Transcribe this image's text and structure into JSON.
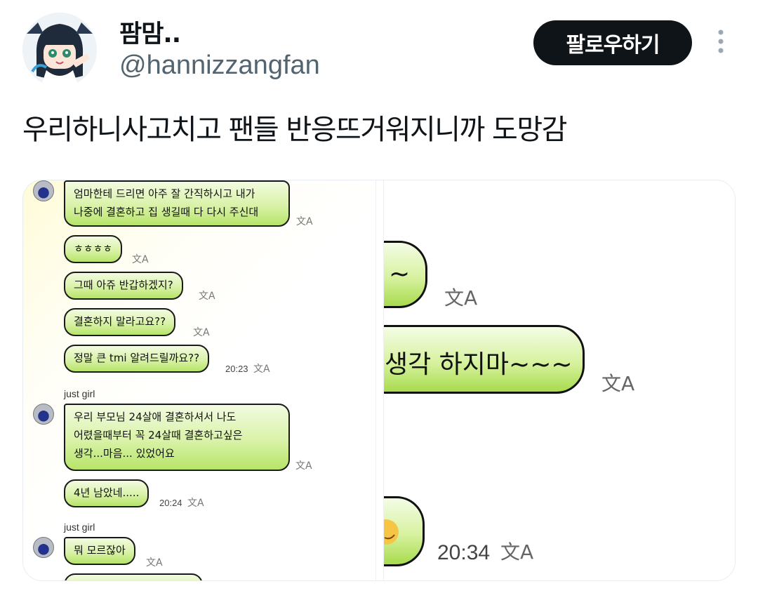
{
  "header": {
    "display_name": "팜맘..",
    "handle": "@hannizzangfan",
    "follow_label": "팔로우하기",
    "more_icon": "more-vertical-icon"
  },
  "tweet": {
    "text": "우리하니사고치고 팬들 반응뜨거워지니까 도망감"
  },
  "chat_left": {
    "bubbles": [
      {
        "line1": "엄마한테 드리면 아주 잘 간직하시고 내가",
        "line2": "나중에 결혼하고 집 생길때 다 다시 주신대"
      },
      {
        "text": "ㅎㅎㅎㅎ"
      },
      {
        "text": "그때 아쥬 반갑하겠지?"
      },
      {
        "text": "결혼하지 말라고요??"
      },
      {
        "text": "정말 큰 tmi 알려드릴까요??",
        "time": "20:23"
      },
      {
        "line1": "우리 부모님 24살애 결혼하셔서 나도",
        "line2": "어렸을때부터 꼭 24살때 결혼하고싶은",
        "line3": "생각...마음... 있었어요"
      },
      {
        "text": "4년 남았네.....",
        "time": "20:24"
      },
      {
        "text": "뭐 모르잖아"
      }
    ],
    "sender_1": "just girl",
    "sender_2": "just girl",
    "translate_glyph": "文A"
  },
  "chat_right": {
    "bubble_1": "~",
    "bubble_2": "생각 하지마~~~",
    "time": "20:34",
    "translate_glyph": "文A"
  }
}
